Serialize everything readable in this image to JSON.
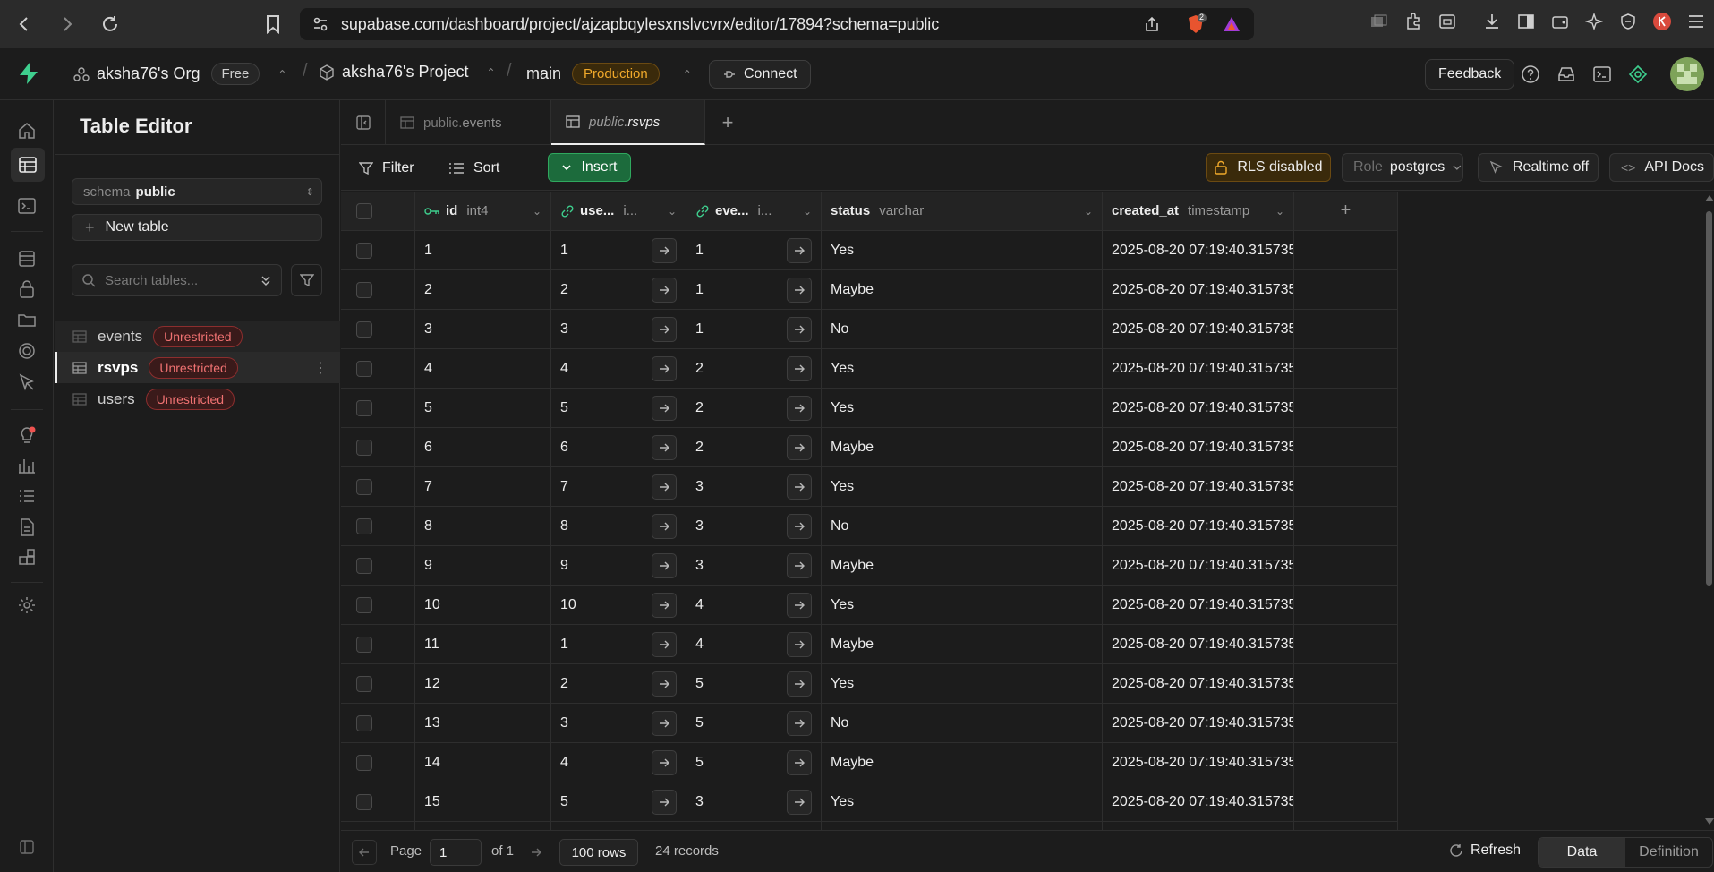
{
  "browser": {
    "url": "supabase.com/dashboard/project/ajzapbqylesxnslvcvrx/editor/17894?schema=public",
    "shield_count": "2"
  },
  "header": {
    "org": "aksha76's Org",
    "plan": "Free",
    "project": "aksha76's Project",
    "branch": "main",
    "environment": "Production",
    "connect": "Connect",
    "feedback": "Feedback"
  },
  "sidebar": {
    "title": "Table Editor",
    "schema_label": "schema",
    "schema_value": "public",
    "new_table": "New table",
    "search_placeholder": "Search tables...",
    "tables": [
      {
        "name": "events",
        "badge": "Unrestricted"
      },
      {
        "name": "rsvps",
        "badge": "Unrestricted"
      },
      {
        "name": "users",
        "badge": "Unrestricted"
      }
    ]
  },
  "tabs": [
    {
      "schema": "public.",
      "name": "events"
    },
    {
      "schema": "public.",
      "name": "rsvps"
    }
  ],
  "toolbar": {
    "filter": "Filter",
    "sort": "Sort",
    "insert": "Insert",
    "rls": "RLS disabled",
    "role_label": "Role",
    "role_value": "postgres",
    "realtime": "Realtime off",
    "api_docs": "API Docs"
  },
  "columns": [
    {
      "name": "id",
      "type": "int4"
    },
    {
      "name": "use...",
      "type": "i..."
    },
    {
      "name": "eve...",
      "type": "i..."
    },
    {
      "name": "status",
      "type": "varchar"
    },
    {
      "name": "created_at",
      "type": "timestamp"
    }
  ],
  "rows": [
    {
      "id": "1",
      "user": "1",
      "event": "1",
      "status": "Yes",
      "created": "2025-08-20 07:19:40.315735"
    },
    {
      "id": "2",
      "user": "2",
      "event": "1",
      "status": "Maybe",
      "created": "2025-08-20 07:19:40.315735"
    },
    {
      "id": "3",
      "user": "3",
      "event": "1",
      "status": "No",
      "created": "2025-08-20 07:19:40.315735"
    },
    {
      "id": "4",
      "user": "4",
      "event": "2",
      "status": "Yes",
      "created": "2025-08-20 07:19:40.315735"
    },
    {
      "id": "5",
      "user": "5",
      "event": "2",
      "status": "Yes",
      "created": "2025-08-20 07:19:40.315735"
    },
    {
      "id": "6",
      "user": "6",
      "event": "2",
      "status": "Maybe",
      "created": "2025-08-20 07:19:40.315735"
    },
    {
      "id": "7",
      "user": "7",
      "event": "3",
      "status": "Yes",
      "created": "2025-08-20 07:19:40.315735"
    },
    {
      "id": "8",
      "user": "8",
      "event": "3",
      "status": "No",
      "created": "2025-08-20 07:19:40.315735"
    },
    {
      "id": "9",
      "user": "9",
      "event": "3",
      "status": "Maybe",
      "created": "2025-08-20 07:19:40.315735"
    },
    {
      "id": "10",
      "user": "10",
      "event": "4",
      "status": "Yes",
      "created": "2025-08-20 07:19:40.315735"
    },
    {
      "id": "11",
      "user": "1",
      "event": "4",
      "status": "Maybe",
      "created": "2025-08-20 07:19:40.315735"
    },
    {
      "id": "12",
      "user": "2",
      "event": "5",
      "status": "Yes",
      "created": "2025-08-20 07:19:40.315735"
    },
    {
      "id": "13",
      "user": "3",
      "event": "5",
      "status": "No",
      "created": "2025-08-20 07:19:40.315735"
    },
    {
      "id": "14",
      "user": "4",
      "event": "5",
      "status": "Maybe",
      "created": "2025-08-20 07:19:40.315735"
    },
    {
      "id": "15",
      "user": "5",
      "event": "3",
      "status": "Yes",
      "created": "2025-08-20 07:19:40.315735"
    }
  ],
  "footer": {
    "page_label": "Page",
    "page_value": "1",
    "of_label": "of 1",
    "rows_per_page": "100 rows",
    "records": "24 records",
    "refresh": "Refresh",
    "view_data": "Data",
    "view_definition": "Definition"
  },
  "colors": {
    "accent_green": "#3ecf8e",
    "production": "#f0a92b",
    "unrestricted": "#f07272"
  }
}
